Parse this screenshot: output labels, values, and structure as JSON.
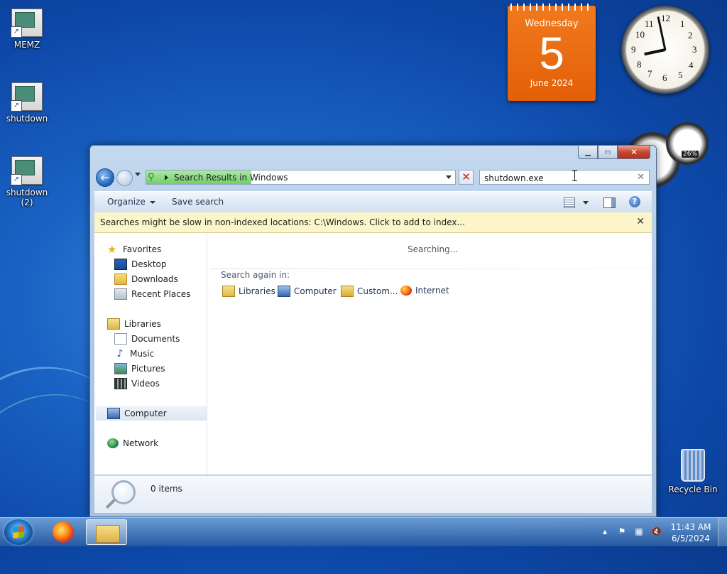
{
  "desktop": {
    "icons": [
      {
        "label": "MEMZ"
      },
      {
        "label": "shutdown"
      },
      {
        "label": "shutdown (2)"
      }
    ],
    "recycle_bin": {
      "label": "Recycle Bin"
    }
  },
  "gadgets": {
    "calendar": {
      "weekday": "Wednesday",
      "day": "5",
      "month_year": "June 2024"
    },
    "clock": {
      "numbers": [
        "12",
        "1",
        "2",
        "3",
        "4",
        "5",
        "6",
        "7",
        "8",
        "9",
        "10",
        "11"
      ]
    },
    "cpu_meter": {
      "percent": "26%"
    }
  },
  "window": {
    "address": {
      "text": "Search Results in Windows",
      "progress_fraction": 0.34
    },
    "search": {
      "value": "shutdown.exe"
    },
    "toolbar": {
      "organize": "Organize",
      "save_search": "Save search"
    },
    "infobar": {
      "message": "Searches might be slow in non-indexed locations: C:\\Windows. Click to add to index..."
    },
    "nav": {
      "favorites": "Favorites",
      "desktop": "Desktop",
      "downloads": "Downloads",
      "recent_places": "Recent Places",
      "libraries": "Libraries",
      "documents": "Documents",
      "music": "Music",
      "pictures": "Pictures",
      "videos": "Videos",
      "computer": "Computer",
      "network": "Network"
    },
    "content": {
      "status": "Searching...",
      "search_again_label": "Search again in:",
      "search_again_items": [
        "Libraries",
        "Computer",
        "Custom...",
        "Internet"
      ]
    },
    "details": {
      "item_count": "0 items"
    }
  },
  "taskbar": {
    "time": "11:43 AM",
    "date": "6/5/2024"
  }
}
